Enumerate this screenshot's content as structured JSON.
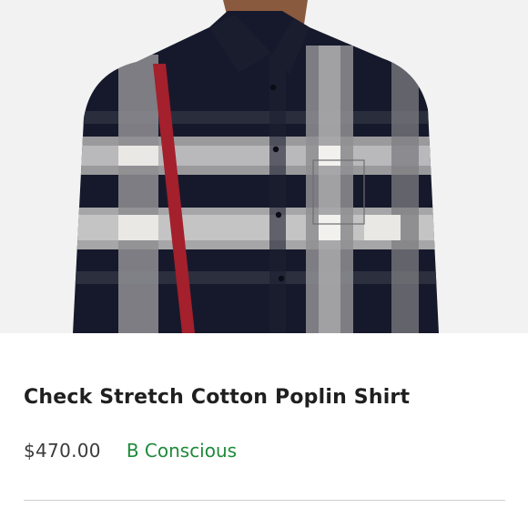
{
  "product": {
    "image_alt": "Check shirt product photo",
    "title": "Check Stretch Cotton Poplin Shirt",
    "price": "$470.00",
    "brand": "B Conscious"
  },
  "colors": {
    "photo_background": "#f2f2f2",
    "shirt_navy": "#16192b",
    "check_grey": "#9a9a9d",
    "check_white": "#e9e8e4",
    "stripe_red": "#a3202c",
    "brand_green": "#1e8a3a",
    "divider": "#cfcfcf"
  }
}
